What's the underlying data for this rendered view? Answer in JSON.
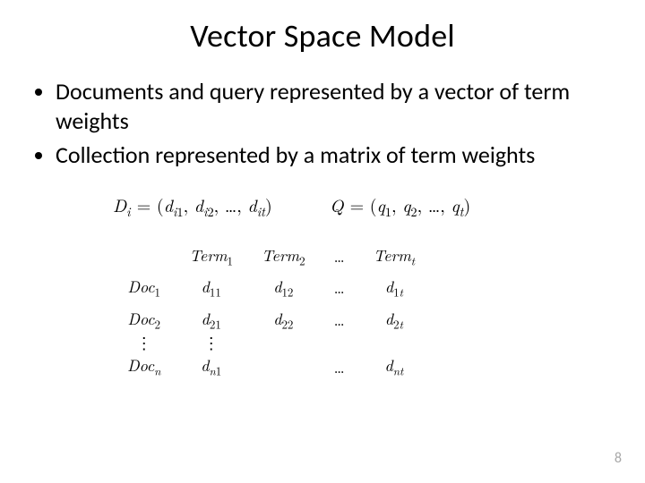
{
  "title": "Vector Space Model",
  "bullets": [
    "Documents and query represented by a vector of term weights",
    "Collection represented by a matrix of term weights"
  ],
  "equations": {
    "doc_vector": "D_i = (d_{i1}, d_{i2}, …, d_{it})",
    "query_vector": "Q = (q_1, q_2, …, q_t)"
  },
  "matrix": {
    "col_headers": [
      "Term_1",
      "Term_2",
      "…",
      "Term_t"
    ],
    "rows": [
      {
        "label": "Doc_1",
        "cells": [
          "d_{11}",
          "d_{12}",
          "…",
          "d_{1t}"
        ]
      },
      {
        "label": "Doc_2",
        "cells": [
          "d_{21}",
          "d_{22}",
          "…",
          "d_{2t}"
        ]
      },
      {
        "label": "⋮",
        "cells": [
          "⋮",
          "",
          "",
          ""
        ]
      },
      {
        "label": "Doc_n",
        "cells": [
          "d_{n1}",
          "",
          "…",
          "d_{nt}"
        ]
      }
    ]
  },
  "page_number": "8"
}
